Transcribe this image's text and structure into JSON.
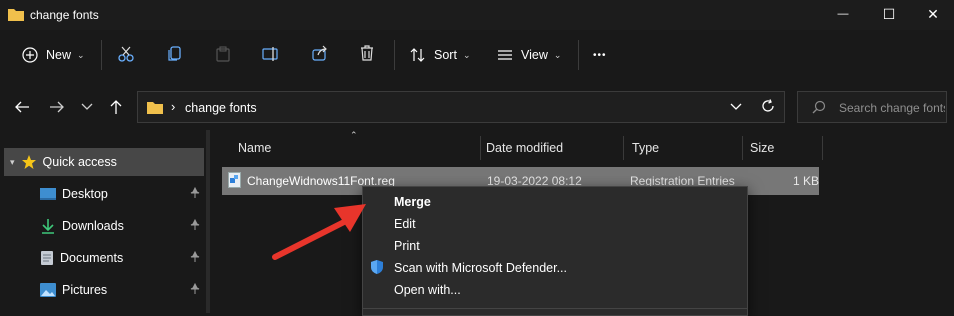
{
  "window": {
    "title": "change fonts",
    "minimize_glyph": "—",
    "maximize_glyph": "☐",
    "close_glyph": "✕"
  },
  "toolbar": {
    "new_label": "New",
    "sort_label": "Sort",
    "view_label": "View",
    "more_glyph": "•••",
    "icons": [
      "new-icon",
      "cut-icon",
      "copy-icon",
      "paste-icon",
      "rename-icon",
      "share-icon",
      "delete-icon",
      "sort-icon",
      "view-icon",
      "more-icon"
    ]
  },
  "address": {
    "separator": "›",
    "folder": "change fonts",
    "search_placeholder": "Search change fonts"
  },
  "nav": {
    "items": [
      {
        "label": "Quick access"
      },
      {
        "label": "Desktop"
      },
      {
        "label": "Downloads"
      },
      {
        "label": "Documents"
      },
      {
        "label": "Pictures"
      }
    ]
  },
  "columns": {
    "name": "Name",
    "date": "Date modified",
    "type": "Type",
    "size": "Size"
  },
  "file": {
    "name": "ChangeWidnows11Font.reg",
    "date": "19-03-2022 08:12",
    "type": "Registration Entries",
    "size": "1 KB"
  },
  "context_menu": {
    "items": [
      {
        "label": "Merge"
      },
      {
        "label": "Edit"
      },
      {
        "label": "Print"
      },
      {
        "label": "Scan with Microsoft Defender..."
      },
      {
        "label": "Open with..."
      }
    ]
  },
  "colors": {
    "background": "#191919",
    "selection": "#777777",
    "folder": "#f0c04c",
    "arrow": "#e8352b",
    "defender_blue": "#2d7fd8"
  }
}
